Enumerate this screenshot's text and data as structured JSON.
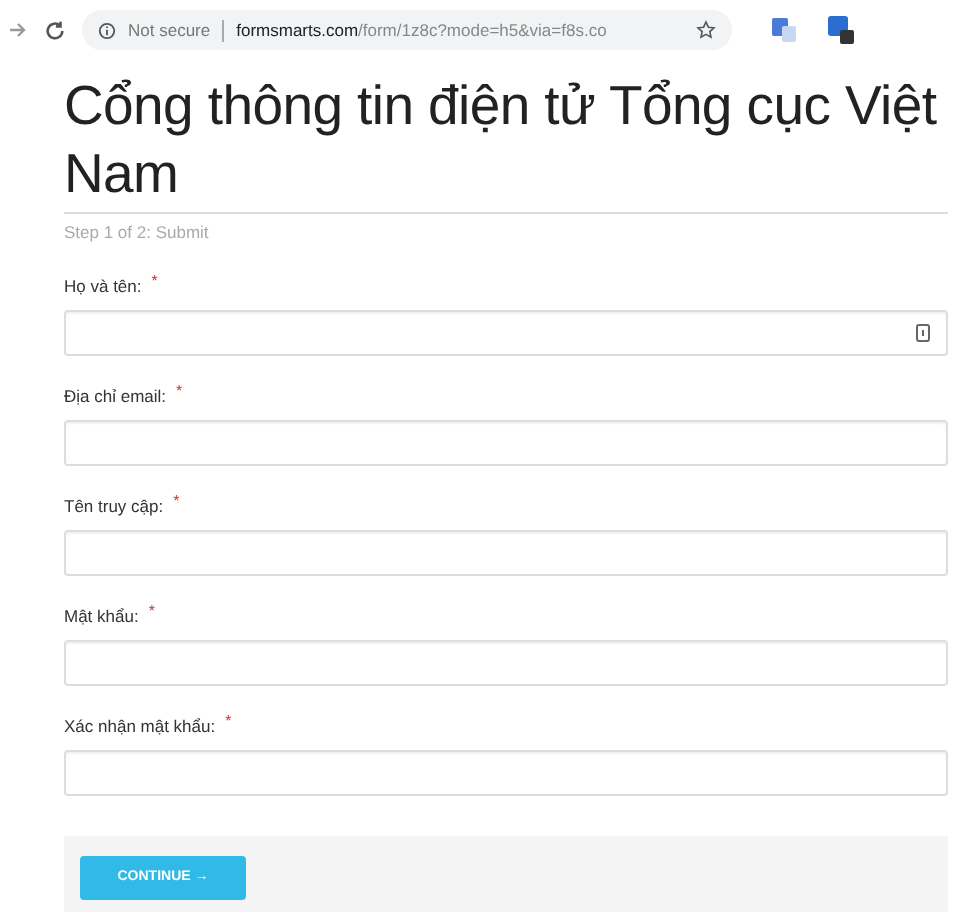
{
  "browser": {
    "security": "Not secure",
    "url_host": "formsmarts.com",
    "url_path": "/form/1z8c?mode=h5&via=f8s.co"
  },
  "form": {
    "title": "Cổng thông tin điện tử Tổng cục Việt Nam",
    "step": "Step 1 of 2: Submit",
    "fields": [
      {
        "label": "Họ và tên:",
        "required_mark": "*",
        "autofill_icon": true
      },
      {
        "label": "Địa chỉ email:",
        "required_mark": "*",
        "autofill_icon": false
      },
      {
        "label": "Tên truy cập:",
        "required_mark": "*",
        "autofill_icon": false
      },
      {
        "label": "Mật khẩu:",
        "required_mark": "*",
        "autofill_icon": false
      },
      {
        "label": "Xác nhận mật khẩu:",
        "required_mark": "*",
        "autofill_icon": false
      }
    ],
    "button": "CONTINUE →"
  }
}
